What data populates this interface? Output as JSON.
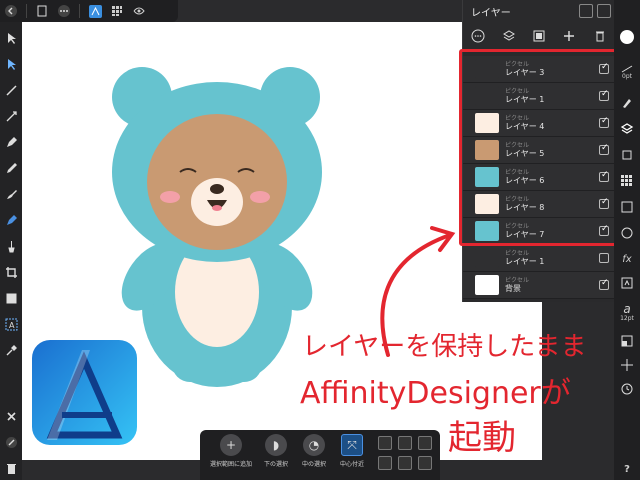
{
  "layers_panel": {
    "title": "レイヤー",
    "rows": [
      {
        "type": "ピクセル",
        "name": "レイヤー 3",
        "visible": true
      },
      {
        "type": "ピクセル",
        "name": "レイヤー 1",
        "visible": true
      },
      {
        "type": "ピクセル",
        "name": "レイヤー 4",
        "visible": true
      },
      {
        "type": "ピクセル",
        "name": "レイヤー 5",
        "visible": true
      },
      {
        "type": "ピクセル",
        "name": "レイヤー 6",
        "visible": true
      },
      {
        "type": "ピクセル",
        "name": "レイヤー 8",
        "visible": true
      },
      {
        "type": "ピクセル",
        "name": "レイヤー 7",
        "visible": true
      },
      {
        "type": "ピクセル",
        "name": "レイヤー 1",
        "visible": false
      },
      {
        "type": "ピクセル",
        "name": "背景",
        "visible": true
      }
    ]
  },
  "context_toolbar": {
    "add_selection": "選択範囲に追加",
    "select_below": "下の選択",
    "select_inside": "中の選択",
    "center": "中心付近"
  },
  "right_strip": {
    "stroke_size": "0pt",
    "font_size": "12pt",
    "fx": "fx",
    "help": "?"
  },
  "overlay": {
    "line1": "レイヤーを保持したまま",
    "line2": "AffinityDesignerが",
    "line3": "起動"
  },
  "colors": {
    "accent_red": "#e3262f",
    "bear_blue": "#66c3cf",
    "bear_brown": "#c99a72",
    "bear_cream": "#fdeee2",
    "app_icon_blue": "#1e8fe0"
  }
}
